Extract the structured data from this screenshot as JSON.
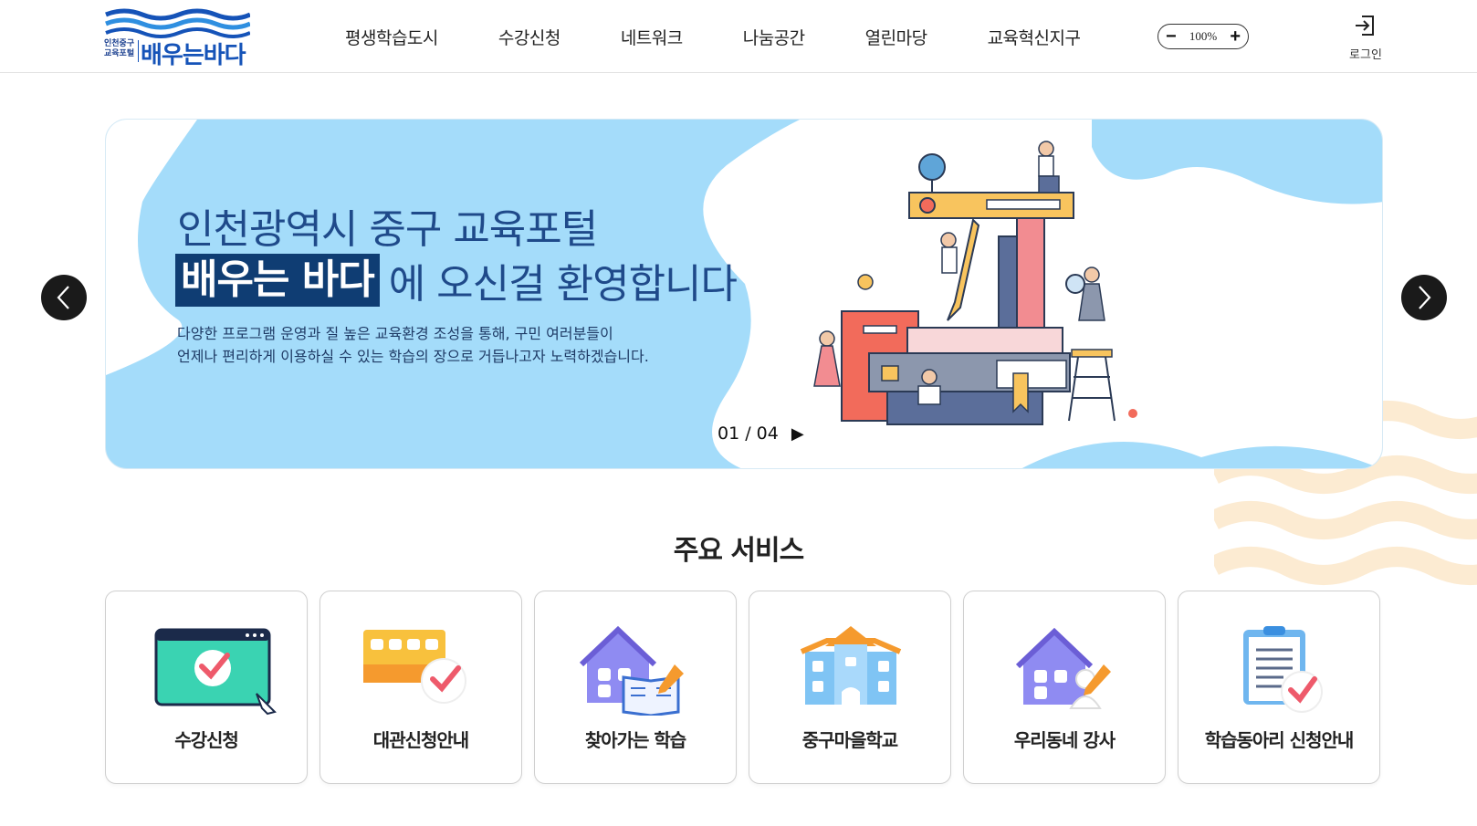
{
  "header": {
    "logo": {
      "small_text": "인천중구 교육포털",
      "main_text": "배우는바다"
    },
    "nav": [
      "평생학습도시",
      "수강신청",
      "네트워크",
      "나눔공간",
      "열린마당",
      "교육혁신지구"
    ],
    "zoom": {
      "minus": "−",
      "value": "100%",
      "plus": "+"
    },
    "login_label": "로그인"
  },
  "banner": {
    "line1": "인천광역시 중구 교육포털",
    "highlight": "배우는 바다",
    "line2_rest": "에 오신걸 환영합니다",
    "desc1": "다양한 프로그램 운영과 질 높은 교육환경 조성을 통해, 구민 여러분들이",
    "desc2": "언제나 편리하게 이용하실 수 있는 학습의 장으로 거듭나고자 노력하겠습니다.",
    "pager": "01 / 04",
    "play_icon": "▶"
  },
  "services": {
    "title": "주요 서비스",
    "items": [
      {
        "label": "수강신청",
        "icon": "browser-check-icon"
      },
      {
        "label": "대관신청안내",
        "icon": "building-check-icon"
      },
      {
        "label": "찾아가는 학습",
        "icon": "house-book-icon"
      },
      {
        "label": "중구마을학교",
        "icon": "school-icon"
      },
      {
        "label": "우리동네 강사",
        "icon": "house-teacher-icon"
      },
      {
        "label": "학습동아리 신청안내",
        "icon": "clipboard-check-icon"
      }
    ]
  },
  "colors": {
    "brand": "#1553b8",
    "banner_bg": "#a4dcfa",
    "highlight_bg": "#0f3d73",
    "wave": "#fcebd2"
  }
}
